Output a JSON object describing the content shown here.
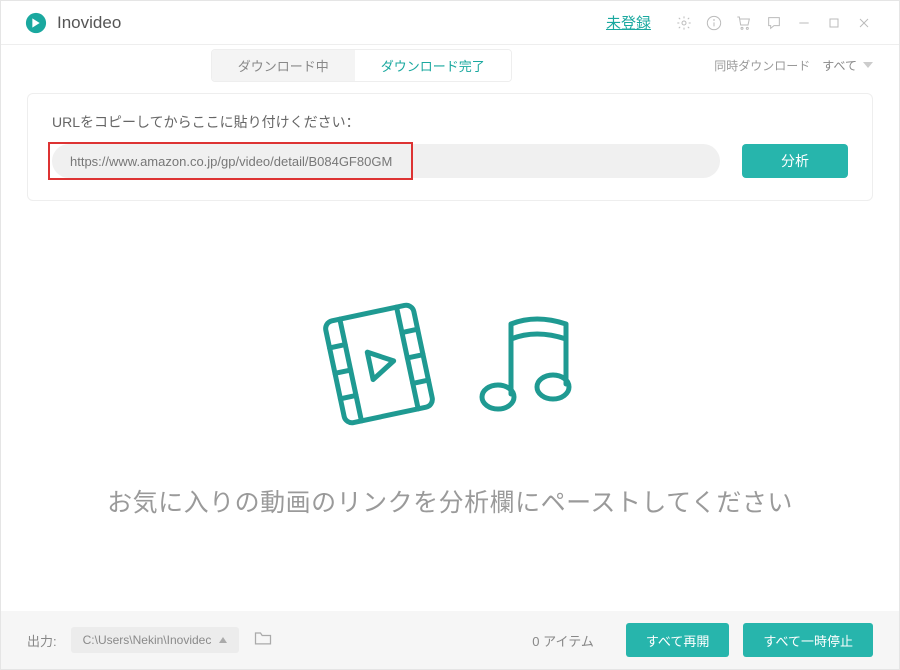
{
  "app": {
    "title": "Inovideo"
  },
  "titlebar": {
    "login": "未登録"
  },
  "tabs": {
    "downloading": "ダウンロード中",
    "completed": "ダウンロード完了"
  },
  "concurrent": {
    "label": "同時ダウンロード",
    "value": "すべて"
  },
  "url_section": {
    "label": "URLをコピーしてからここに貼り付けください：",
    "value": "https://www.amazon.co.jp/gp/video/detail/B084GF80GM",
    "analyze": "分析"
  },
  "empty_state": {
    "message": "お気に入りの動画のリンクを分析欄にペーストしてください"
  },
  "footer": {
    "output_label": "出力:",
    "output_path": "C:\\Users\\Nekin\\Inovidec",
    "item_count": "0 アイテム",
    "resume_all": "すべて再開",
    "pause_all": "すべて一時停止"
  },
  "colors": {
    "accent": "#27b5ac",
    "highlight": "#d33"
  }
}
